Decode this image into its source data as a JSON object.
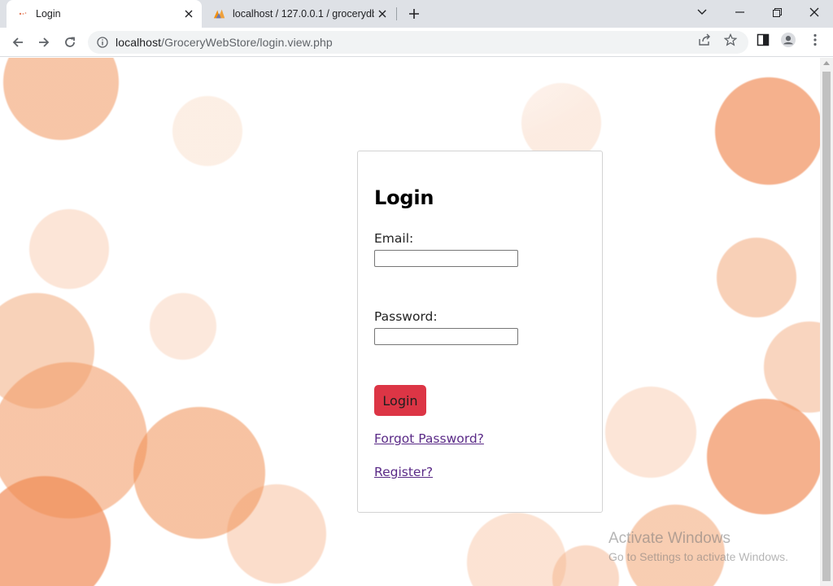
{
  "browser": {
    "tabs": [
      {
        "title": "Login",
        "active": true,
        "favicon": "dots-favicon-icon"
      },
      {
        "title": "localhost / 127.0.0.1 / grocerydb",
        "active": false,
        "favicon": "phpmyadmin-favicon-icon"
      }
    ],
    "url_host": "localhost",
    "url_path": "/GroceryWebStore/login.view.php"
  },
  "login": {
    "heading": "Login",
    "email_label": "Email:",
    "email_value": "",
    "password_label": "Password:",
    "password_value": "",
    "submit_label": "Login",
    "forgot_link": "Forgot Password?",
    "register_link": "Register?"
  },
  "watermark": {
    "title": "Activate Windows",
    "subtitle": "Go to Settings to activate Windows."
  },
  "colors": {
    "accent_button": "#dc3545",
    "link": "#5a2a87",
    "blob": "#f09660"
  }
}
